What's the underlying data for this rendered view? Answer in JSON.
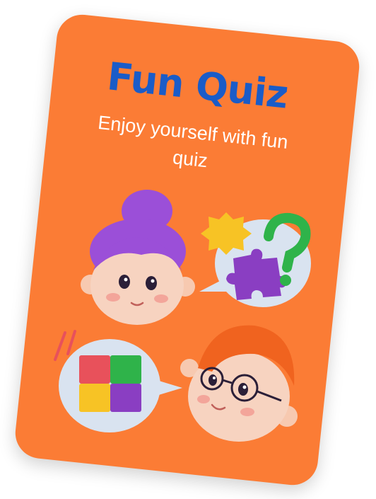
{
  "card": {
    "title": "Fun Quiz",
    "subtitle": "Enjoy yourself with fun quiz"
  },
  "colors": {
    "card_background": "#fb7c35",
    "title": "#1a5cc8",
    "subtitle": "#ffffff"
  },
  "illustration": {
    "characters": [
      "girl-character",
      "boy-character"
    ],
    "icons": [
      "puzzle-icon",
      "question-mark-icon",
      "star-badge-icon"
    ]
  }
}
